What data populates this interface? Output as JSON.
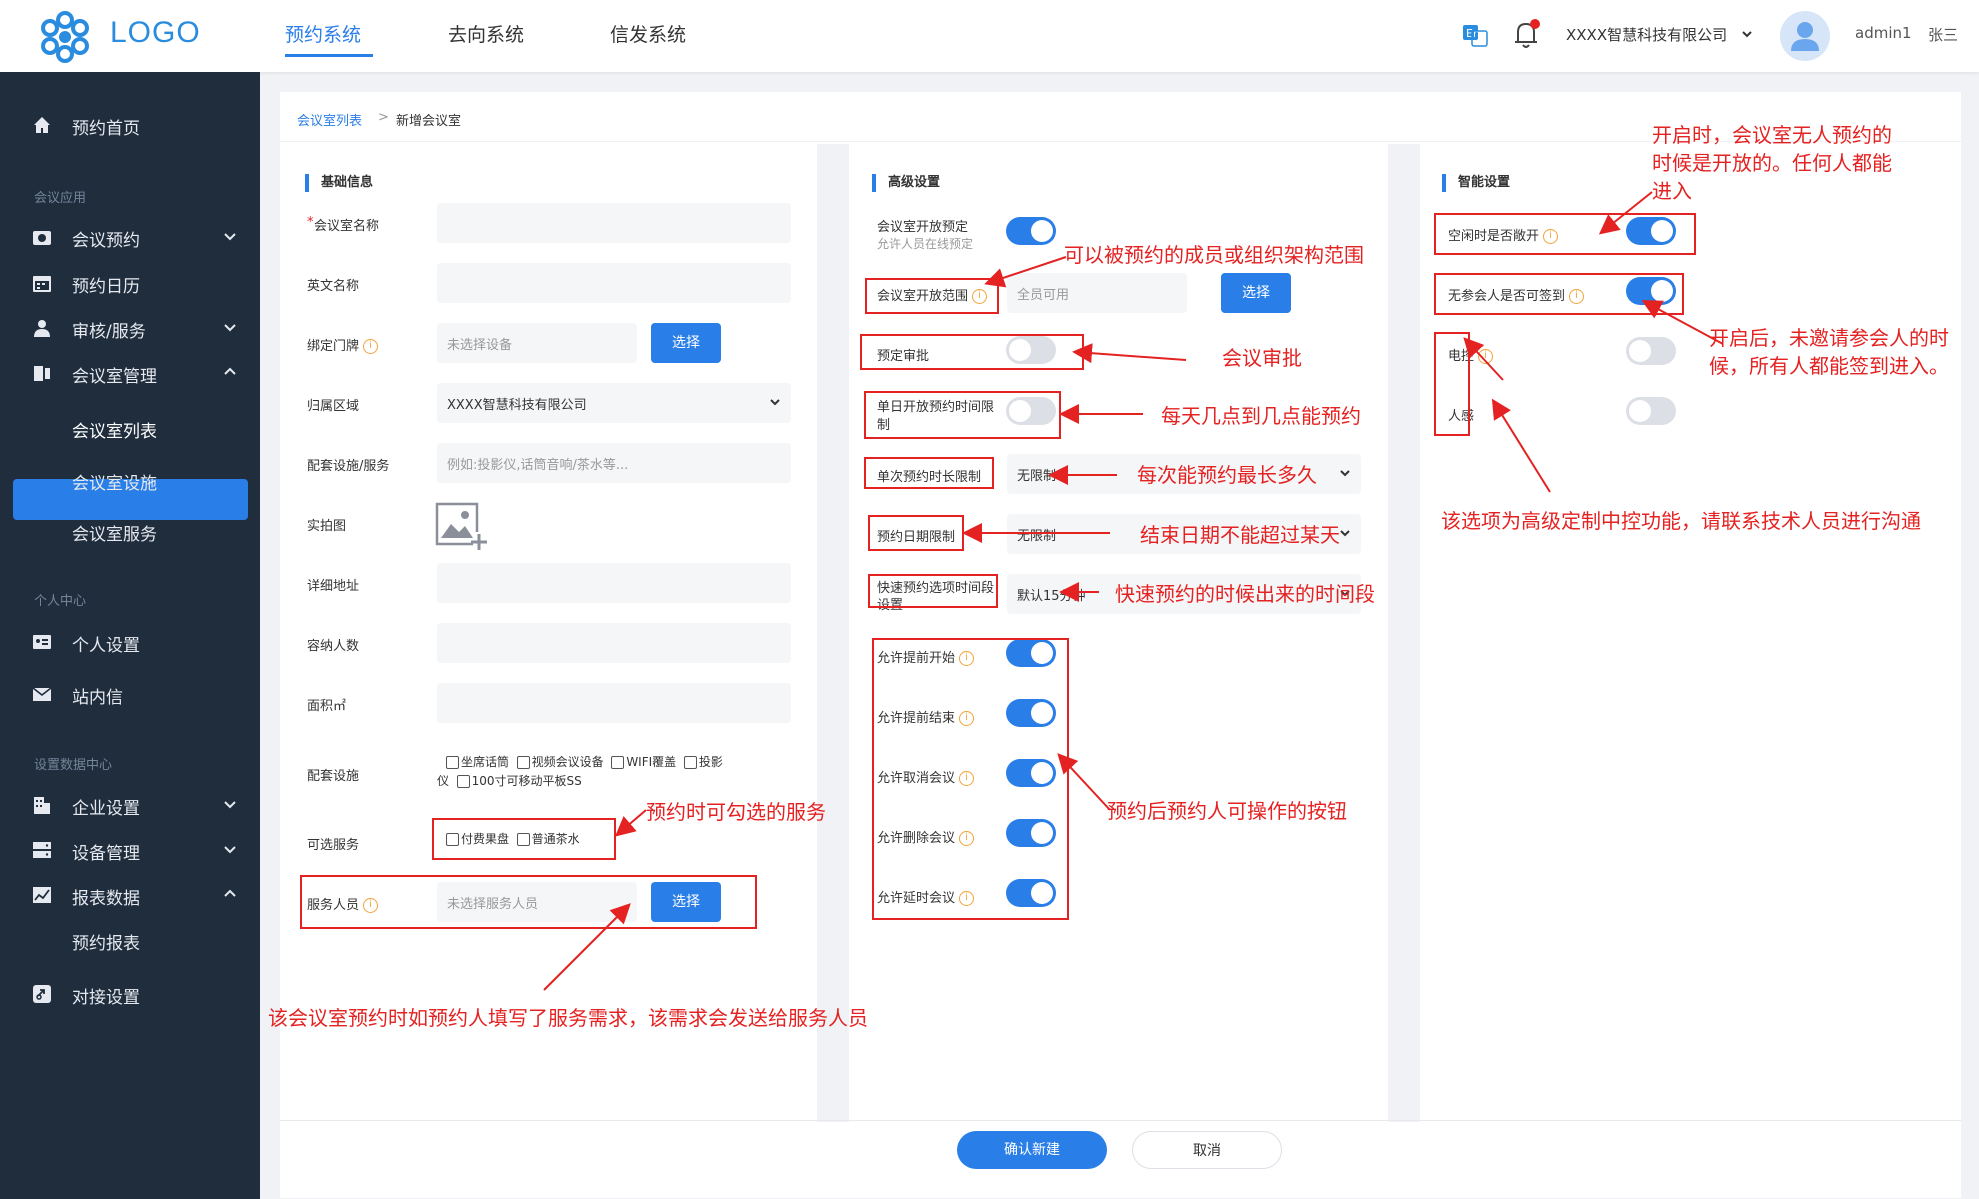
{
  "header": {
    "logo_text": "LOGO",
    "nav": [
      "预约系统",
      "去向系统",
      "信发系统"
    ],
    "active_nav": 0,
    "company": "XXXX智慧科技有限公司",
    "user": "admin1",
    "user_name": "张三"
  },
  "sidebar": {
    "home": "预约首页",
    "sec_meeting": "会议应用",
    "meeting_booking": "会议预约",
    "booking_calendar": "预约日历",
    "audit_service": "审核/服务",
    "room_mgmt": "会议室管理",
    "room_list": "会议室列表",
    "room_facility": "会议室设施",
    "room_service": "会议室服务",
    "sec_personal": "个人中心",
    "personal_settings": "个人设置",
    "inbox": "站内信",
    "sec_settings": "设置数据中心",
    "enterprise_settings": "企业设置",
    "device_mgmt": "设备管理",
    "report_data": "报表数据",
    "booking_report": "预约报表",
    "integration": "对接设置"
  },
  "breadcrumb": {
    "parent": "会议室列表",
    "sep": ">",
    "current": "新增会议室"
  },
  "basic": {
    "title": "基础信息",
    "name_star": "*",
    "name_label": "会议室名称",
    "en_label": "英文名称",
    "door_label": "绑定门牌",
    "door_placeholder": "未选择设备",
    "select_btn": "选择",
    "area_label": "归属区域",
    "area_value": "XXXX智慧科技有限公司",
    "facility_label": "配套设施/服务",
    "facility_placeholder": "例如:投影仪,话筒音响/茶水等...",
    "photo_label": "实拍图",
    "addr_label": "详细地址",
    "capacity_label": "容纳人数",
    "size_label": "面积㎡",
    "equip_label": "配套设施",
    "equip_options": [
      "坐席话筒",
      "视频会议设备",
      "WIFI覆盖",
      "投影",
      "仪",
      "100寸可移动平板SS"
    ],
    "optional_label": "可选服务",
    "optional_options": [
      "付费果盘",
      "普通茶水"
    ],
    "staff_label": "服务人员",
    "staff_placeholder": "未选择服务人员"
  },
  "advanced": {
    "title": "高级设置",
    "open_label": "会议室开放预定",
    "open_sub": "允许人员在线预定",
    "scope_label": "会议室开放范围",
    "scope_value": "全员可用",
    "approval_label": "预定审批",
    "daily_label_1": "单日开放预约时间限",
    "daily_label_2": "制",
    "duration_label": "单次预约时长限制",
    "duration_value": "无限制",
    "date_label": "预约日期限制",
    "date_value": "无限制",
    "quick_label_1": "快速预约选项时间段",
    "quick_label_2": "设置",
    "quick_value": "默认15分钟",
    "allow_start": "允许提前开始",
    "allow_end": "允许提前结束",
    "allow_cancel": "允许取消会议",
    "allow_delete": "允许删除会议",
    "allow_extend": "允许延时会议"
  },
  "smart": {
    "title": "智能设置",
    "idle_open": "空闲时是否敞开",
    "no_attendee_sign": "无参会人是否可签到",
    "electric": "电控",
    "sensor": "人感"
  },
  "footer": {
    "confirm": "确认新建",
    "cancel": "取消"
  },
  "annotations": {
    "idle_1": "开启时，会议室无人预约的",
    "idle_2": "时候是开放的。任何人都能",
    "idle_3": "进入",
    "scope": "可以被预约的成员或组织架构范围",
    "approval": "会议审批",
    "daily": "每天几点到几点能预约",
    "duration": "每次能预约最长多久",
    "date": "结束日期不能超过某天",
    "quick": "快速预约的时候出来的时间段",
    "sign_1": "开启后，未邀请参会人的时",
    "sign_2": "候，所有人都能签到进入。",
    "custom": "该选项为高级定制中控功能，请联系技术人员进行沟通",
    "optional": "预约时可勾选的服务",
    "ops": "预约后预约人可操作的按钮",
    "staff": "该会议室预约时如预约人填写了服务需求，该需求会发送给服务人员"
  },
  "colors": {
    "accent": "#2a7ee8",
    "sidebar": "#1f2d3d",
    "annotation": "#e52222",
    "info": "#f2a43a"
  }
}
